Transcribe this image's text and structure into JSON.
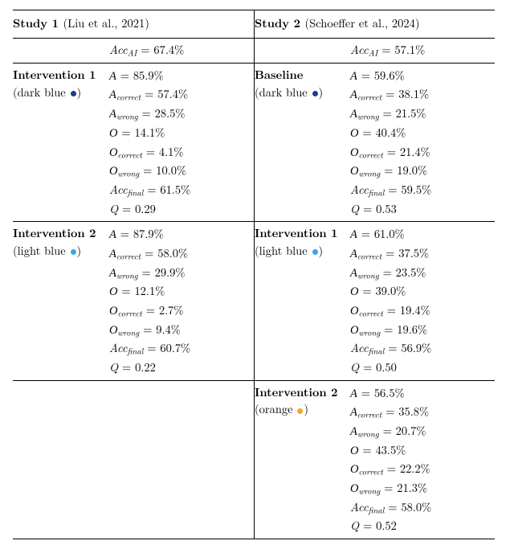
{
  "study1": {
    "header_prefix": "Study 1 ",
    "header_cite": "(Liu et al., 2021)",
    "acc_ai_label": "Acc",
    "acc_ai_sub": "AI",
    "acc_ai_val": " = 67.4%",
    "groups": [
      {
        "title": "Intervention 1",
        "color_label": "(dark blue ",
        "color_label_after": ")",
        "metrics": {
          "A": "85.9%",
          "A_correct": "57.4%",
          "A_wrong": "28.5%",
          "O": "14.1%",
          "O_correct": "4.1%",
          "O_wrong": "10.0%",
          "Acc_final": "61.5%",
          "Q": "0.29"
        }
      },
      {
        "title": "Intervention 2",
        "color_label": "(light blue ",
        "color_label_after": ")",
        "metrics": {
          "A": "87.9%",
          "A_correct": "58.0%",
          "A_wrong": "29.9%",
          "O": "12.1%",
          "O_correct": "2.7%",
          "O_wrong": "9.4%",
          "Acc_final": "60.7%",
          "Q": "0.22"
        }
      }
    ]
  },
  "study2": {
    "header_prefix": "Study 2 ",
    "header_cite": "(Schoeffer et al., 2024)",
    "acc_ai_label": "Acc",
    "acc_ai_sub": "AI",
    "acc_ai_val": " = 57.1%",
    "groups": [
      {
        "title": "Baseline",
        "color_label": "(dark blue ",
        "color_label_after": ")",
        "metrics": {
          "A": "59.6%",
          "A_correct": "38.1%",
          "A_wrong": "21.5%",
          "O": "40.4%",
          "O_correct": "21.4%",
          "O_wrong": "19.0%",
          "Acc_final": "59.5%",
          "Q": "0.53"
        }
      },
      {
        "title": "Intervention 1",
        "color_label": "(light blue ",
        "color_label_after": ")",
        "metrics": {
          "A": "61.0%",
          "A_correct": "37.5%",
          "A_wrong": "23.5%",
          "O": "39.0%",
          "O_correct": "19.4%",
          "O_wrong": "19.6%",
          "Acc_final": "56.9%",
          "Q": "0.50"
        }
      },
      {
        "title": "Intervention 2",
        "color_label": "(orange ",
        "color_label_after": ")",
        "metrics": {
          "A": "56.5%",
          "A_correct": "35.8%",
          "A_wrong": "20.7%",
          "O": "43.5%",
          "O_correct": "22.2%",
          "O_wrong": "21.3%",
          "Acc_final": "58.0%",
          "Q": "0.52"
        }
      }
    ]
  }
}
